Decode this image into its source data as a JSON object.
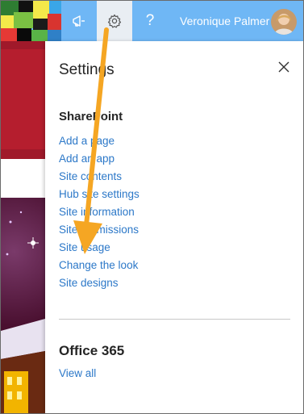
{
  "topbar": {
    "user_name": "Veronique Palmer",
    "icons": [
      "megaphone-icon",
      "gear-icon",
      "help-icon"
    ],
    "help_glyph": "?",
    "accent_color": "#6fb7f5"
  },
  "panel": {
    "title": "Settings",
    "sharepoint": {
      "heading": "SharePoint",
      "links": [
        "Add a page",
        "Add an app",
        "Site contents",
        "Hub site settings",
        "Site information",
        "Site permissions",
        "Site usage",
        "Change the look",
        "Site designs"
      ]
    },
    "office365": {
      "heading": "Office 365",
      "view_all": "View all"
    },
    "link_color": "#2c78c8"
  },
  "annotation": {
    "arrow_color": "#f5a623"
  }
}
